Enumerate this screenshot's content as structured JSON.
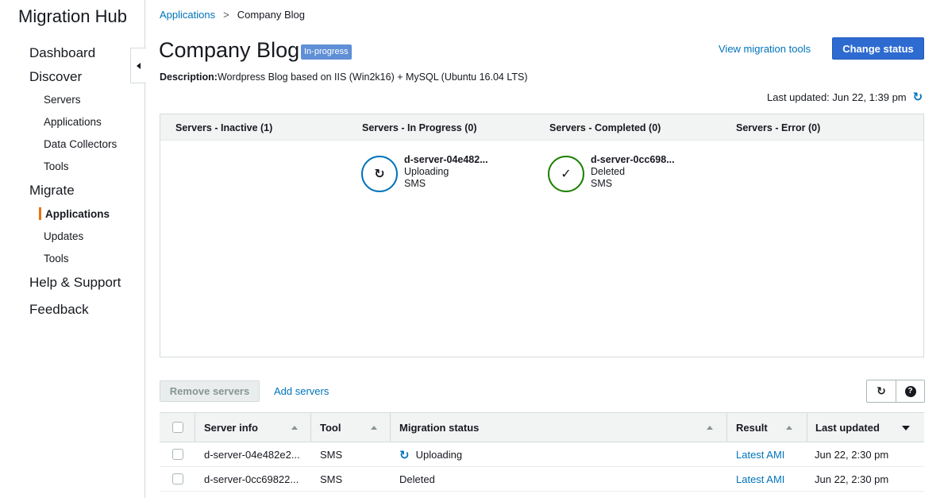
{
  "sidebar": {
    "app_title": "Migration Hub",
    "items": [
      {
        "label": "Dashboard"
      },
      {
        "label": "Discover"
      },
      {
        "label": "Servers"
      },
      {
        "label": "Applications"
      },
      {
        "label": "Data Collectors"
      },
      {
        "label": "Tools"
      },
      {
        "label": "Migrate"
      },
      {
        "label": "Applications"
      },
      {
        "label": "Updates"
      },
      {
        "label": "Tools"
      },
      {
        "label": "Help & Support"
      },
      {
        "label": "Feedback"
      }
    ]
  },
  "breadcrumb": {
    "parent": "Applications",
    "separator": ">",
    "current": "Company Blog"
  },
  "header": {
    "title": "Company Blog",
    "status_badge": "In-progress",
    "description_label": "Description:",
    "description": "Wordpress Blog based on IIS (Win2k16) + MySQL (Ubuntu 16.04 LTS)",
    "view_tools_link": "View migration tools",
    "change_status_button": "Change status",
    "last_updated": "Last updated: Jun 22, 1:39 pm",
    "accent_color": "#2e6bd1",
    "badge_color": "#5f8fd6"
  },
  "board": {
    "columns": [
      {
        "label": "Servers - Inactive (1)"
      },
      {
        "label": "Servers - In Progress (0)"
      },
      {
        "label": "Servers - Completed (0)"
      },
      {
        "label": "Servers - Error (0)"
      }
    ],
    "cards": [
      {
        "name": "d-server-04e482...",
        "status": "Uploading",
        "tool": "SMS",
        "icon": "refresh-icon",
        "color": "#0073bb"
      },
      {
        "name": "d-server-0cc698...",
        "status": "Deleted",
        "tool": "SMS",
        "icon": "check-icon",
        "color": "#1d8102"
      }
    ]
  },
  "actions": {
    "remove_servers": "Remove servers",
    "add_servers": "Add servers"
  },
  "table": {
    "headers": {
      "server_info": "Server info",
      "tool": "Tool",
      "migration_status": "Migration status",
      "result": "Result",
      "last_updated": "Last updated"
    },
    "rows": [
      {
        "server_info": "d-server-04e482e2...",
        "tool": "SMS",
        "migration_status": "Uploading",
        "status_icon": "refresh-icon",
        "result": "Latest AMI",
        "last_updated": "Jun 22, 2:30 pm"
      },
      {
        "server_info": "d-server-0cc69822...",
        "tool": "SMS",
        "migration_status": "Deleted",
        "result": "Latest AMI",
        "last_updated": "Jun 22, 2:30 pm"
      }
    ]
  }
}
